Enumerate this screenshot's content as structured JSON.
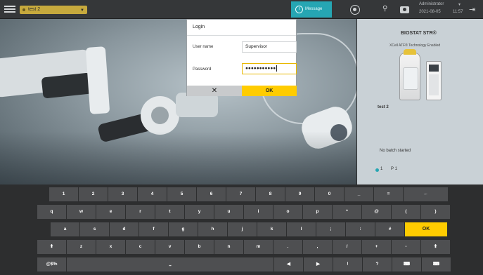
{
  "topbar": {
    "selector_value": "test 2",
    "message_label": "Message",
    "user": "Administrator",
    "date": "2021-08-05",
    "time": "11:57"
  },
  "login": {
    "title": "Login",
    "username_label": "User name",
    "username_value": "Supervisor",
    "password_label": "Password",
    "password_value": "●●●●●●●●●●●",
    "cancel_label": "✕",
    "ok_label": "OK"
  },
  "right_panel": {
    "title": "BIOSTAT STR®",
    "subtitle": "XCell ATF® Technology Enabled",
    "device_name": "test 2",
    "batch_status": "No batch started",
    "count_1": "1",
    "count_2_prefix": "P",
    "count_2": "1"
  },
  "keyboard": {
    "row1": [
      "1",
      "2",
      "3",
      "4",
      "5",
      "6",
      "7",
      "8",
      "9",
      "0",
      "_",
      "=",
      "←"
    ],
    "row2": [
      "q",
      "w",
      "e",
      "r",
      "t",
      "y",
      "u",
      "i",
      "o",
      "p",
      "*",
      "@",
      "(",
      ")"
    ],
    "row3": [
      "a",
      "s",
      "d",
      "f",
      "g",
      "h",
      "j",
      "k",
      "l",
      ";",
      ":",
      "#",
      "OK"
    ],
    "row4": [
      "⬆",
      "z",
      "x",
      "c",
      "v",
      "b",
      "n",
      "m",
      ".",
      ",",
      "/",
      "+",
      "-",
      "⬆"
    ],
    "row5": [
      "@$%",
      "⎵",
      "◀",
      "▶",
      "!",
      "?",
      "⌨",
      "⌨"
    ]
  },
  "colors": {
    "accent_yellow": "#ffcc00",
    "accent_teal": "#26a6b3",
    "selector_bg": "#c6a93d"
  }
}
